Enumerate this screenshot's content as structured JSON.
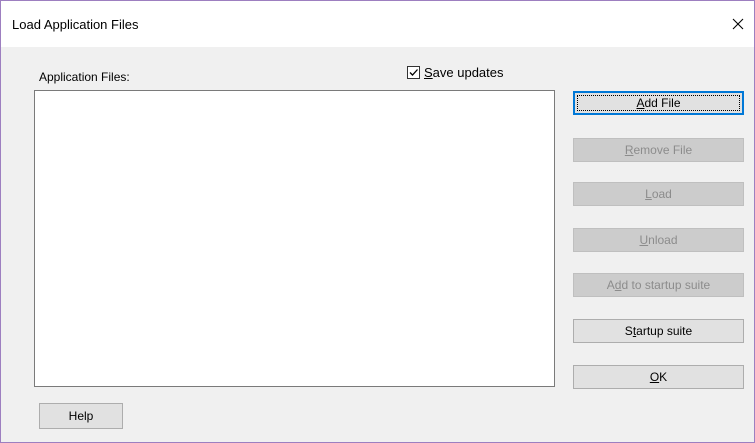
{
  "window": {
    "title": "Load Application Files",
    "close_icon": "close-icon"
  },
  "files_label": "Application Files:",
  "save_updates": {
    "label_accel": "S",
    "label_rest": "ave updates",
    "checked": true
  },
  "buttons": {
    "add_file": {
      "accel": "A",
      "rest": "dd File",
      "enabled": true,
      "default": true
    },
    "remove_file": {
      "accel": "R",
      "rest": "emove File",
      "enabled": false
    },
    "load": {
      "accel": "L",
      "rest": "oad",
      "enabled": false
    },
    "unload": {
      "accel": "U",
      "rest": "nload",
      "enabled": false
    },
    "add_to_startup": {
      "pre": "A",
      "accel": "d",
      "rest": "d to startup suite",
      "enabled": false
    },
    "startup_suite": {
      "pre": "S",
      "accel": "t",
      "rest": "artup suite",
      "enabled": true
    },
    "ok": {
      "accel": "O",
      "rest": "K",
      "enabled": true
    },
    "help": {
      "label": "Help",
      "enabled": true
    }
  },
  "colors": {
    "window_border": "#9d7fc0",
    "default_button_border": "#0078d7",
    "disabled_text": "#8c8c8c"
  }
}
